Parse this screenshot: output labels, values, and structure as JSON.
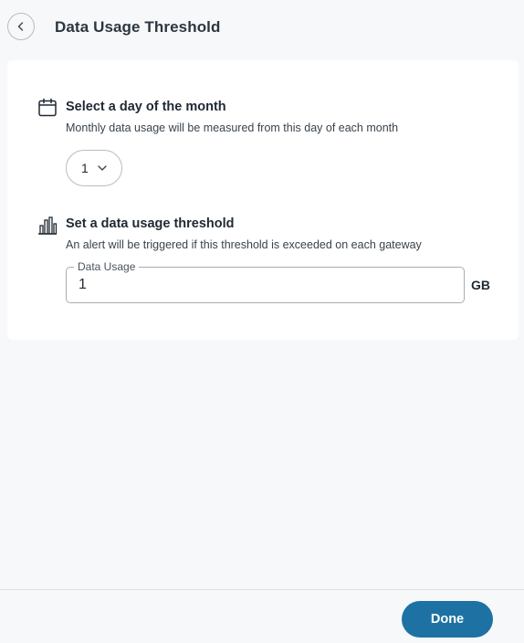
{
  "header": {
    "title": "Data Usage Threshold",
    "back_icon": "chevron-left-icon"
  },
  "day_section": {
    "icon": "calendar-icon",
    "title": "Select a day of the month",
    "description": "Monthly data usage will be measured from this day of each month",
    "selected_day": "1"
  },
  "threshold_section": {
    "icon": "bar-chart-icon",
    "title": "Set a data usage threshold",
    "description": "An alert will be triggered if this threshold is exceeded on each gateway",
    "field_label": "Data Usage",
    "field_value": "1",
    "unit": "GB"
  },
  "footer": {
    "done_label": "Done"
  },
  "colors": {
    "accent": "#1d72a3",
    "background": "#f7f8fa",
    "card": "#ffffff"
  }
}
